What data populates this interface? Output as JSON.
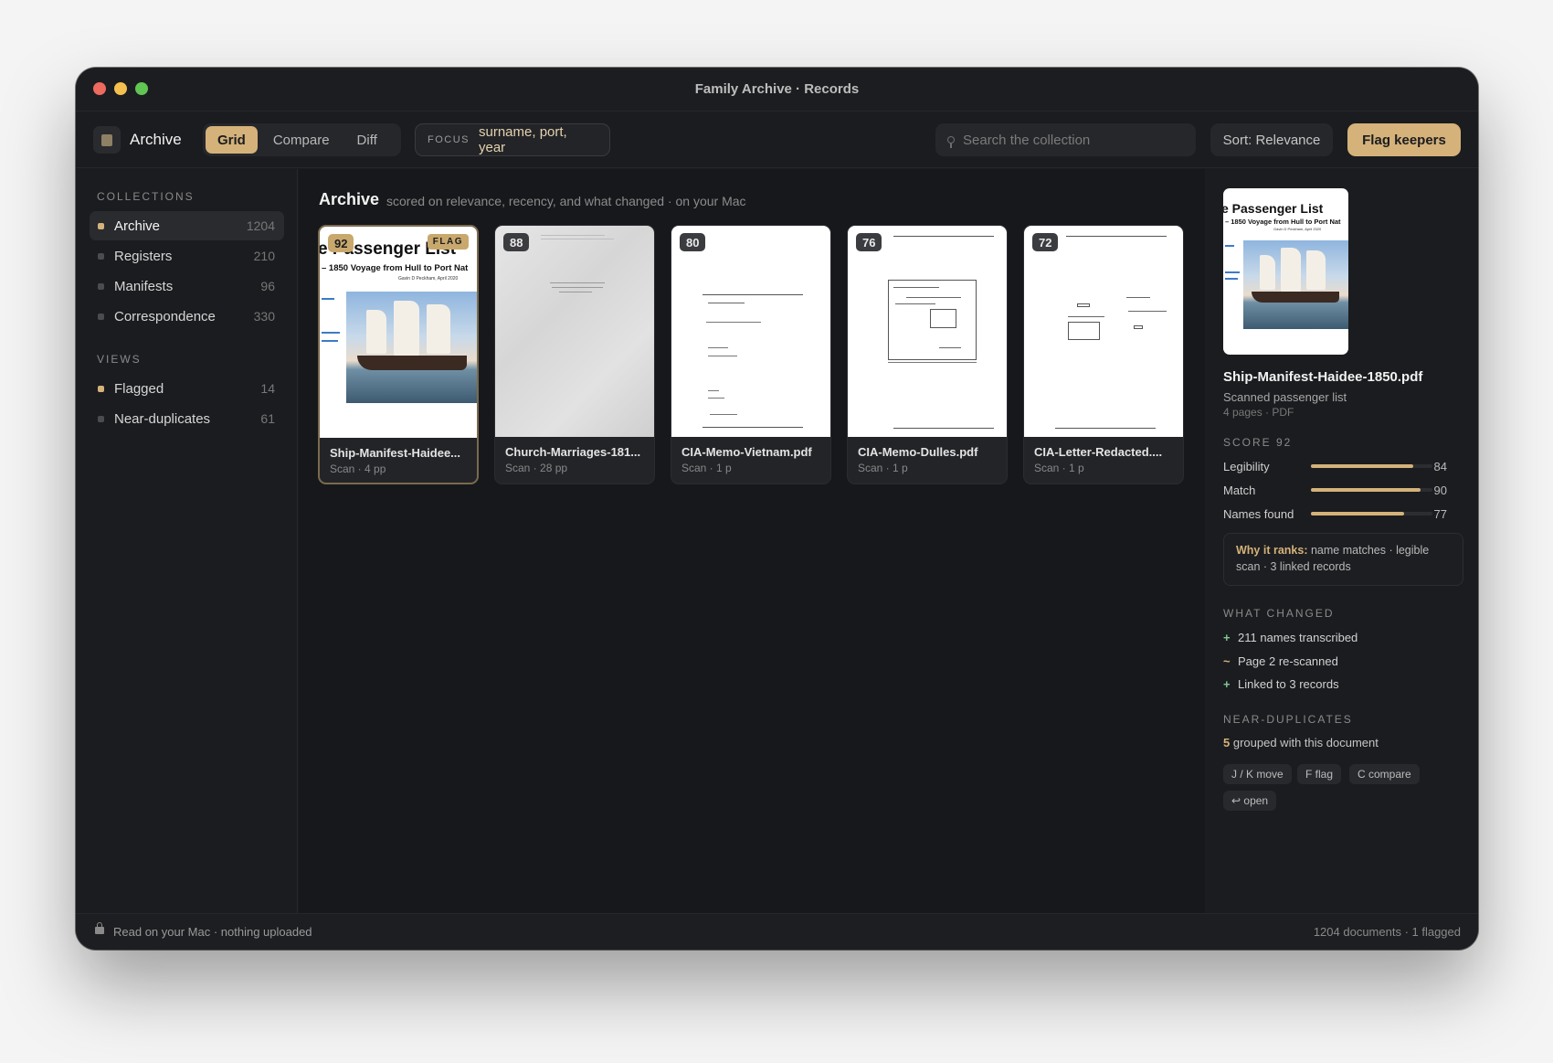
{
  "window": {
    "title": "Family Archive · Records"
  },
  "toolbar": {
    "app_name": "Archive",
    "tabs": [
      {
        "label": "Grid"
      },
      {
        "label": "Compare"
      },
      {
        "label": "Diff"
      }
    ],
    "focus_label": "FOCUS",
    "focus_value": "surname, port, year",
    "search_placeholder": "Search the collection",
    "sort_label": "Sort: Relevance",
    "flag_button": "Flag keepers"
  },
  "sidebar": {
    "collections_title": "COLLECTIONS",
    "collections": [
      {
        "label": "Archive",
        "count": "1204",
        "dot": "#d4b27a"
      },
      {
        "label": "Registers",
        "count": "210",
        "dot": "#4b4c50"
      },
      {
        "label": "Manifests",
        "count": "96",
        "dot": "#4b4c50"
      },
      {
        "label": "Correspondence",
        "count": "330",
        "dot": "#4b4c50"
      }
    ],
    "views_title": "VIEWS",
    "views": [
      {
        "label": "Flagged",
        "count": "14",
        "dot": "#d4b27a"
      },
      {
        "label": "Near-duplicates",
        "count": "61",
        "dot": "#4b4c50"
      }
    ]
  },
  "main": {
    "title": "Archive",
    "subtitle": "scored on relevance, recency, and what changed · on your Mac",
    "cards": [
      {
        "score": "92",
        "flag": "FLAG",
        "name": "Ship-Manifest-Haidee...",
        "meta": "Scan · 4 pp",
        "thumb_title": "e Passenger List",
        "thumb_subtitle": "– 1850 Voyage from Hull to Port Nat",
        "thumb_author": "Gavin D Peckham, April 2020"
      },
      {
        "score": "88",
        "name": "Church-Marriages-181...",
        "meta": "Scan · 28 pp"
      },
      {
        "score": "80",
        "name": "CIA-Memo-Vietnam.pdf",
        "meta": "Scan · 1 p"
      },
      {
        "score": "76",
        "name": "CIA-Memo-Dulles.pdf",
        "meta": "Scan · 1 p"
      },
      {
        "score": "72",
        "name": "CIA-Letter-Redacted....",
        "meta": "Scan · 1 p"
      }
    ]
  },
  "detail": {
    "preview_title": "e Passenger List",
    "preview_subtitle": "– 1850 Voyage from Hull to Port Nat",
    "preview_author": "Gavin D Peckham, April 2020",
    "filename": "Ship-Manifest-Haidee-1850.pdf",
    "description": "Scanned passenger list",
    "meta": "4 pages · PDF",
    "score_label": "SCORE 92",
    "metrics": [
      {
        "name": "Legibility",
        "value": "84",
        "fraction": 0.84
      },
      {
        "name": "Match",
        "value": "90",
        "fraction": 0.9
      },
      {
        "name": "Names found",
        "value": "77",
        "fraction": 0.77
      }
    ],
    "why_label": "Why it ranks:",
    "why_text": "name matches · legible scan · 3 linked records",
    "changed_title": "WHAT CHANGED",
    "changes": [
      {
        "symbol": "+",
        "text": "211 names transcribed"
      },
      {
        "symbol": "~",
        "text": "Page 2 re-scanned"
      },
      {
        "symbol": "+",
        "text": "Linked to 3 records"
      }
    ],
    "dups_title": "NEAR-DUPLICATES",
    "dups_count": "5",
    "dups_text": "grouped with this document",
    "shortcuts": [
      "J / K move",
      "F flag",
      "C compare",
      "↩ open"
    ]
  },
  "status": {
    "left": "Read on your Mac · nothing uploaded",
    "right": "1204 documents · 1 flagged"
  },
  "colors": {
    "accent": "#d4b27a",
    "close": "#ed6a5e",
    "minimize": "#f5bf4f",
    "zoom": "#61c554"
  }
}
